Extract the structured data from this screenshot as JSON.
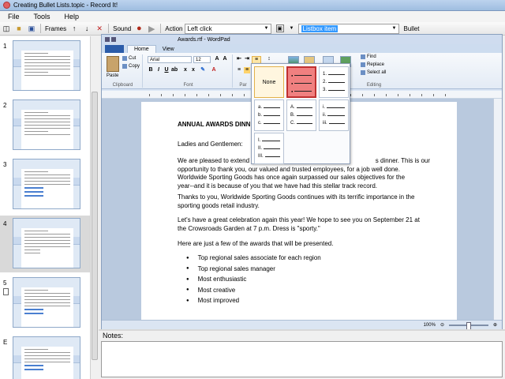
{
  "window": {
    "title": "Creating Bullet Lists.topic - Record It!"
  },
  "menu": [
    "File",
    "Tools",
    "Help"
  ],
  "toolbar": {
    "frames_label": "Frames",
    "sound_label": "Sound",
    "action_label": "Action",
    "action_value": "Left click",
    "listbox_value": "Listbox item",
    "item_value": "Bullet"
  },
  "frames": [
    {
      "number": "1"
    },
    {
      "number": "2"
    },
    {
      "number": "3"
    },
    {
      "number": "4",
      "selected": true
    },
    {
      "number": "5",
      "has_doc_icon": true
    },
    {
      "number": "E"
    }
  ],
  "wordpad": {
    "title": "Awards.rtf - WordPad",
    "tabs": [
      "Home",
      "View"
    ],
    "clipboard": {
      "paste": "Paste",
      "cut": "Cut",
      "copy": "Copy",
      "label": "Clipboard"
    },
    "font": {
      "family": "Arial",
      "size": "12",
      "label": "Font"
    },
    "paragraph_label": "Par",
    "editing": {
      "find": "Find",
      "replace": "Replace",
      "select_all": "Select all",
      "label": "Editing"
    },
    "zoom": "100%"
  },
  "document": {
    "heading": "ANNUAL AWARDS DINNE",
    "greeting": "Ladies and Gentlemen:",
    "p1_line1": "We are pleased to extend to",
    "p1_line1_tail": "s dinner.  This is our",
    "p1_line2": "opportunity to thank you, our valued and trusted employees, for a job well done.",
    "p1_line3": "Worldwide Sporting Goods has once again surpassed our sales objectives for the",
    "p1_line4": "year--and it is because of you that we have had this stellar track record.",
    "p2_line1": "Thanks to you, Worldwide Sporting Goods continues with its terrific importance in the",
    "p2_line2": "sporting goods retail industry.",
    "p3_line1": "Let's have a great celebration again this year!  We hope to see you on September 21 at",
    "p3_line2": "the Crowsroads Garden at 7 p.m. Dress is \"sporty.\"",
    "p4": "Here are just a few of the awards that will be presented.",
    "bullets": [
      "Top regional sales associate for each region",
      "Top regional sales manager",
      "Most enthusiastic",
      "Most creative",
      "Most improved"
    ]
  },
  "list_menu": {
    "none": "None",
    "numbered": [
      "1.",
      "2.",
      "3."
    ],
    "lower_alpha": [
      "a.",
      "b.",
      "c."
    ],
    "upper_alpha": [
      "A.",
      "B.",
      "C."
    ],
    "lower_roman": [
      "i.",
      "ii.",
      "iii."
    ],
    "upper_roman": [
      "I.",
      "II.",
      "III."
    ]
  },
  "notes": {
    "label": "Notes:"
  }
}
